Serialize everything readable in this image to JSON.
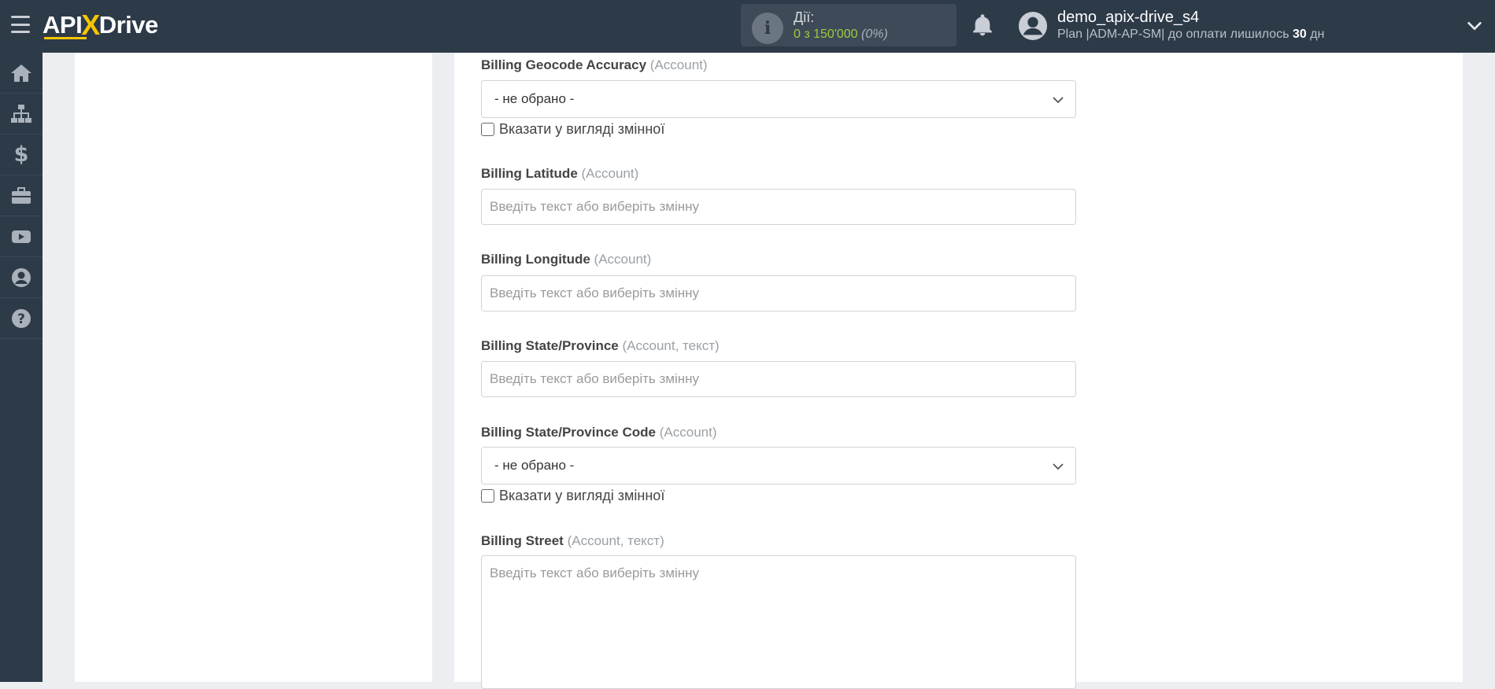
{
  "header": {
    "logo": {
      "part1": "API",
      "x": "X",
      "part2": "Drive"
    },
    "actions": {
      "label": "Дії:",
      "count": "0 з 150'000",
      "percent": "(0%)"
    },
    "user": {
      "name": "demo_apix-drive_s4",
      "plan_prefix": "Plan |ADM-AP-SM| до оплати лишилось ",
      "days": "30",
      "days_suffix": " дн"
    }
  },
  "sidebar": {
    "items": [
      {
        "icon": "home-icon"
      },
      {
        "icon": "sitemap-icon"
      },
      {
        "icon": "dollar-icon"
      },
      {
        "icon": "briefcase-icon"
      },
      {
        "icon": "youtube-icon"
      },
      {
        "icon": "user-circle-icon"
      },
      {
        "icon": "help-icon"
      }
    ]
  },
  "form": {
    "geocode": {
      "label": "Billing Geocode Accuracy",
      "sub": "(Account)",
      "value": "- не обрано -",
      "checkbox": "Вказати у вигляді змінної"
    },
    "latitude": {
      "label": "Billing Latitude",
      "sub": "(Account)",
      "placeholder": "Введіть текст або виберіть змінну"
    },
    "longitude": {
      "label": "Billing Longitude",
      "sub": "(Account)",
      "placeholder": "Введіть текст або виберіть змінну"
    },
    "state": {
      "label": "Billing State/Province",
      "sub": "(Account, текст)",
      "placeholder": "Введіть текст або виберіть змінну"
    },
    "state_code": {
      "label": "Billing State/Province Code",
      "sub": "(Account)",
      "value": "- не обрано -",
      "checkbox": "Вказати у вигляді змінної"
    },
    "street": {
      "label": "Billing Street",
      "sub": "(Account, текст)",
      "placeholder": "Введіть текст або виберіть змінну"
    }
  }
}
